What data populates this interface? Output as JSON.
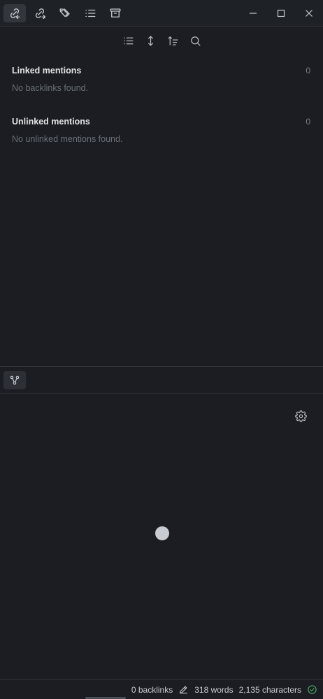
{
  "tabs": [
    {
      "icon": "backlinks-icon",
      "active": true
    },
    {
      "icon": "outgoing-links-icon",
      "active": false
    },
    {
      "icon": "tags-icon",
      "active": false
    },
    {
      "icon": "outline-icon",
      "active": false
    },
    {
      "icon": "archive-icon",
      "active": false
    }
  ],
  "window_controls": [
    "minimize-icon",
    "maximize-icon",
    "close-icon"
  ],
  "toolbar": [
    "collapse-results-icon",
    "show-more-context-icon",
    "sort-icon",
    "search-icon"
  ],
  "linked": {
    "title": "Linked mentions",
    "count": "0",
    "empty": "No backlinks found."
  },
  "unlinked": {
    "title": "Unlinked mentions",
    "count": "0",
    "empty": "No unlinked mentions found."
  },
  "graph": {
    "tab_icon": "graph-icon",
    "settings_icon": "gear-icon"
  },
  "status": {
    "backlinks": "0 backlinks",
    "words": "318 words",
    "characters": "2,135 characters"
  },
  "colors": {
    "background": "#1b1d22",
    "node": "#c8ccd2",
    "sync_ok": "#4caf6a"
  }
}
